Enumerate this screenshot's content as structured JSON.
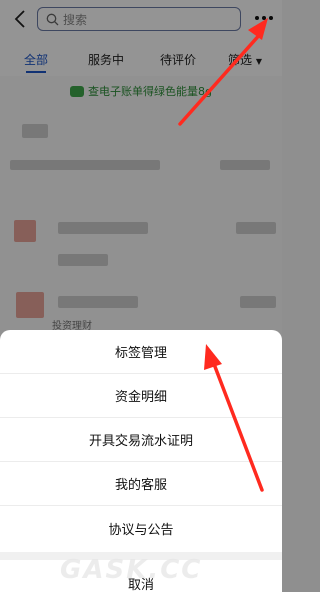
{
  "search": {
    "placeholder": "搜索"
  },
  "tabs": [
    {
      "label": "全部",
      "active": true
    },
    {
      "label": "服务中",
      "active": false
    },
    {
      "label": "待评价",
      "active": false
    },
    {
      "label": "筛选",
      "active": false
    }
  ],
  "banner": {
    "text": "查电子账单得绿色能量8g"
  },
  "list": {
    "faint_label": "投资理财"
  },
  "action_sheet": {
    "items": [
      {
        "label": "标签管理"
      },
      {
        "label": "资金明细"
      },
      {
        "label": "开具交易流水证明"
      },
      {
        "label": "我的客服"
      },
      {
        "label": "协议与公告"
      }
    ],
    "cancel_label": "取消"
  },
  "watermark": "GASK.CC",
  "colors": {
    "accent": "#1e57c9",
    "green": "#3fa84a",
    "arrow": "#ff2a1f"
  }
}
